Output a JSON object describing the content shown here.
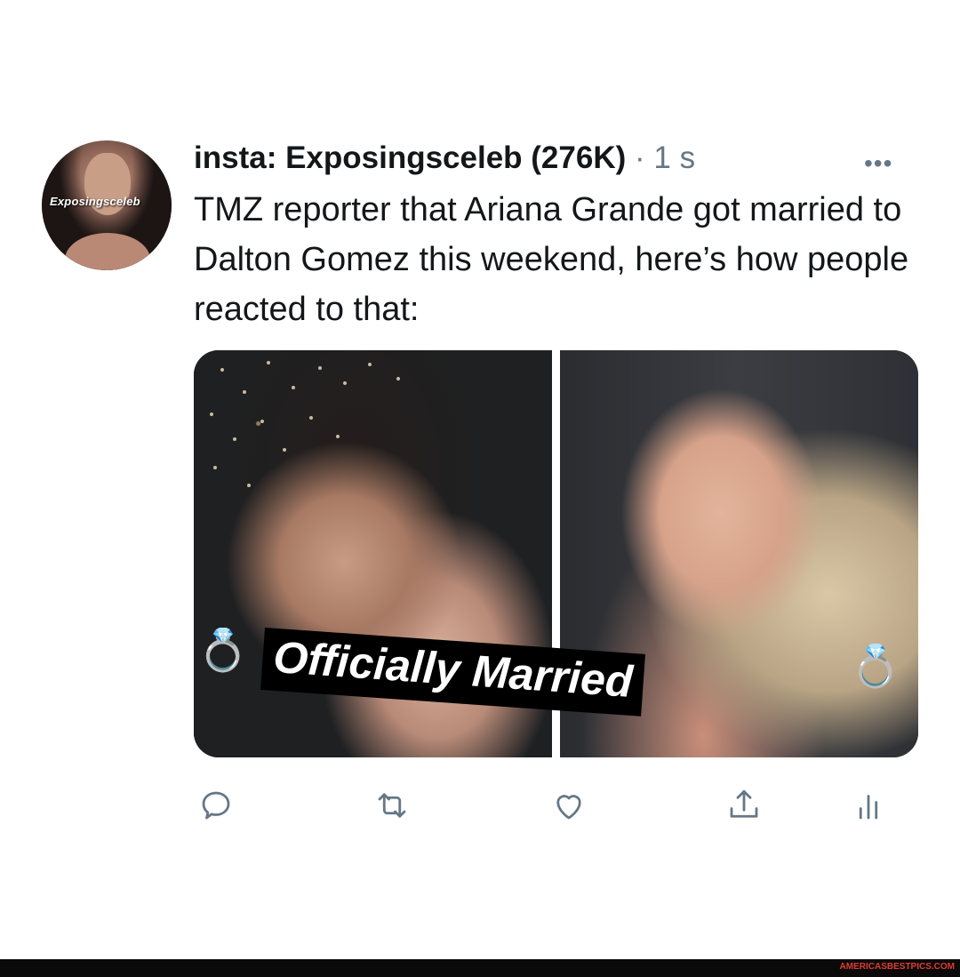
{
  "tweet": {
    "avatar_label": "Exposingsceleb",
    "handle": "insta: Exposingsceleb (276K)",
    "separator": "·",
    "time": "1 s",
    "more_icon": "more-horizontal-icon",
    "text": "TMZ reporter that Ariana Grande got married to Dalton Gomez this weekend, here’s how people reacted to that:",
    "media": {
      "caption": "Officially Married",
      "ring_emoji": "💍"
    }
  },
  "actions": [
    {
      "name": "reply",
      "icon": "comment-icon"
    },
    {
      "name": "retweet",
      "icon": "retweet-icon"
    },
    {
      "name": "like",
      "icon": "heart-icon"
    },
    {
      "name": "share",
      "icon": "share-icon"
    },
    {
      "name": "analytics",
      "icon": "analytics-icon"
    }
  ],
  "footer": {
    "watermark": "AMERICASBESTPICS.COM"
  },
  "colors": {
    "text": "#14171a",
    "muted": "#657786",
    "watermark": "#e03c2f"
  }
}
